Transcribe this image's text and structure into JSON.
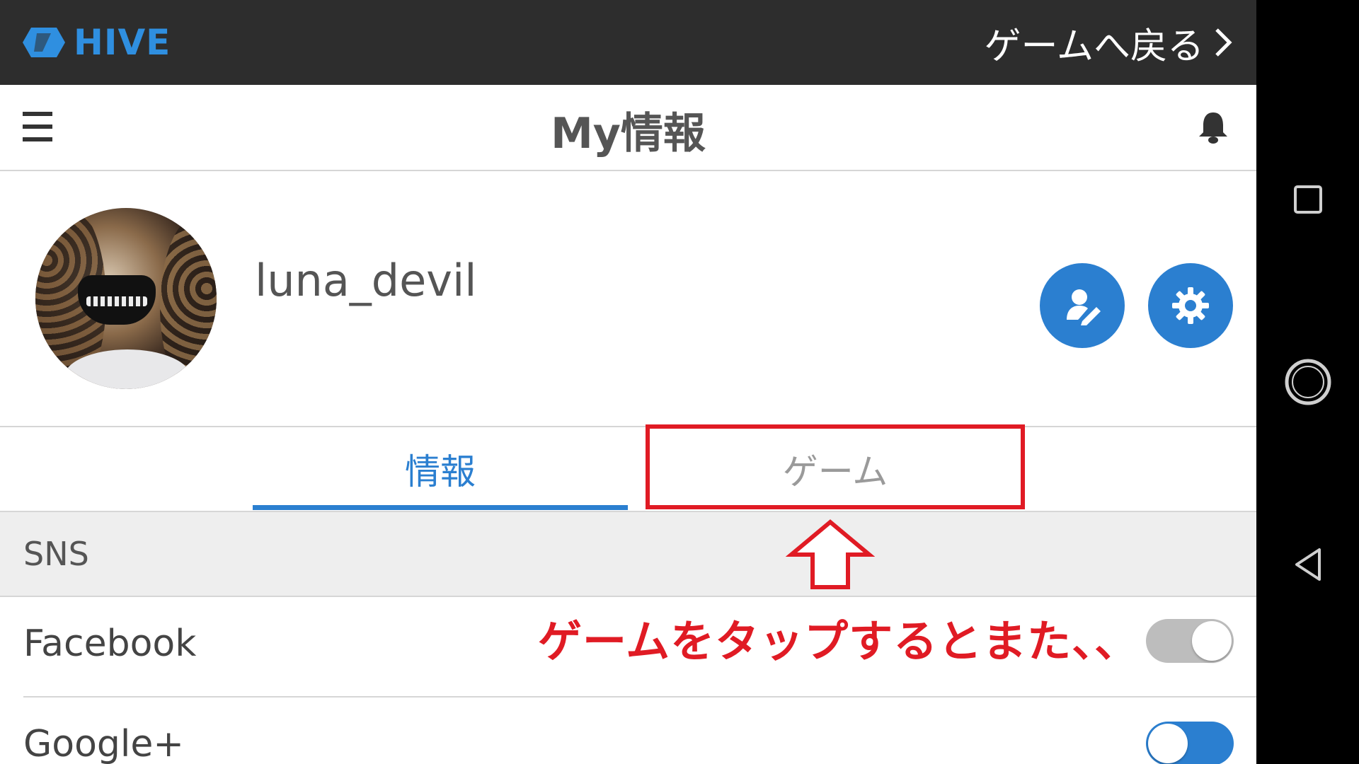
{
  "topbar": {
    "logo_text": "HIVE",
    "back_label": "ゲームへ戻る",
    "back_chevron": "chevron-right-icon"
  },
  "header": {
    "title": "My情報",
    "menu_icon": "hamburger-menu-icon",
    "bell_icon": "bell-icon"
  },
  "profile": {
    "username": "luna_devil",
    "edit_icon": "edit-profile-icon",
    "settings_icon": "gear-icon"
  },
  "tabs": [
    {
      "label": "情報",
      "active": true
    },
    {
      "label": "ゲーム",
      "active": false
    }
  ],
  "section": {
    "label": "SNS"
  },
  "sns": [
    {
      "label": "Facebook",
      "toggle": "off"
    },
    {
      "label": "Google+",
      "toggle": "on"
    }
  ],
  "annotation": {
    "text": "ゲームをタップするとまた、、"
  },
  "colors": {
    "accent": "#2b7fd0",
    "topbar": "#2d2d2d",
    "annotation_red": "#e01b24",
    "section_bg": "#eeeeee"
  },
  "system_nav": [
    "recents-square-icon",
    "home-circle-icon",
    "back-triangle-icon"
  ]
}
